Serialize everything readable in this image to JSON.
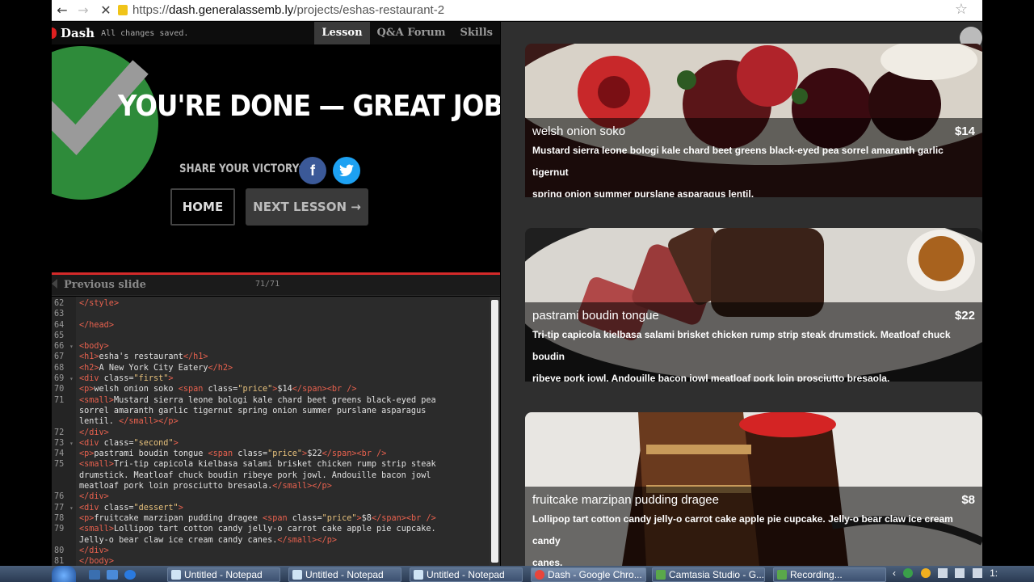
{
  "browser": {
    "url_scheme": "https://",
    "url_host": "dash.generalassemb.ly",
    "url_path": "/projects/eshas-restaurant-2"
  },
  "header": {
    "logo": "Dash",
    "status": "All changes saved.",
    "tabs": [
      {
        "label": "Lesson",
        "active": true
      },
      {
        "label": "Q&A Forum",
        "active": false
      },
      {
        "label": "Skills",
        "active": false
      }
    ]
  },
  "victory": {
    "title": "YOU'RE DONE — GREAT JOB!",
    "share_label": "SHARE YOUR VICTORY:",
    "facebook_glyph": "f",
    "twitter_glyph": "t",
    "home_button": "HOME",
    "next_button": "NEXT LESSON →"
  },
  "slides": {
    "prev_label": "Previous slide",
    "counter": "71/71"
  },
  "editor": {
    "lines": [
      {
        "n": "62",
        "fold": "",
        "t": "</style>"
      },
      {
        "n": "63",
        "fold": "",
        "t": ""
      },
      {
        "n": "64",
        "fold": "",
        "t": "</head>"
      },
      {
        "n": "65",
        "fold": "",
        "t": ""
      },
      {
        "n": "66",
        "fold": "▾",
        "t": "<body>"
      },
      {
        "n": "67",
        "fold": "",
        "t": "<h1>esha's restaurant</h1>"
      },
      {
        "n": "68",
        "fold": "",
        "t": "<h2>A New York City Eatery</h2>"
      },
      {
        "n": "69",
        "fold": "▾",
        "t": "<div class=\"first\">"
      },
      {
        "n": "70",
        "fold": "",
        "t": "<p>welsh onion soko <span class=\"price\">$14</span><br />"
      },
      {
        "n": "71",
        "fold": "",
        "t": "<small>Mustard sierra leone bologi kale chard beet greens black-eyed pea"
      },
      {
        "n": "",
        "fold": "",
        "t": "sorrel amaranth garlic tigernut spring onion summer purslane asparagus"
      },
      {
        "n": "",
        "fold": "",
        "t": "lentil. </small></p>"
      },
      {
        "n": "72",
        "fold": "",
        "t": "</div>"
      },
      {
        "n": "73",
        "fold": "▾",
        "t": "<div class=\"second\">"
      },
      {
        "n": "74",
        "fold": "",
        "t": "<p>pastrami boudin tongue <span class=\"price\">$22</span><br />"
      },
      {
        "n": "75",
        "fold": "",
        "t": "<small>Tri-tip capicola kielbasa salami brisket chicken rump strip steak"
      },
      {
        "n": "",
        "fold": "",
        "t": "drumstick. Meatloaf chuck boudin ribeye pork jowl. Andouille bacon jowl"
      },
      {
        "n": "",
        "fold": "",
        "t": "meatloaf pork loin prosciutto bresaola.</small></p>"
      },
      {
        "n": "76",
        "fold": "",
        "t": "</div>"
      },
      {
        "n": "77",
        "fold": "▾",
        "t": "<div class=\"dessert\">"
      },
      {
        "n": "78",
        "fold": "",
        "t": "<p>fruitcake marzipan pudding dragee <span class=\"price\">$8</span><br />"
      },
      {
        "n": "79",
        "fold": "",
        "t": "<small>Lollipop tart cotton candy jelly-o carrot cake apple pie cupcake."
      },
      {
        "n": "",
        "fold": "",
        "t": "Jelly-o bear claw ice cream candy canes.</small></p>"
      },
      {
        "n": "80",
        "fold": "",
        "t": "</div>"
      },
      {
        "n": "81",
        "fold": "",
        "t": "</body>"
      }
    ]
  },
  "menu": [
    {
      "name": "welsh onion soko",
      "price": "$14",
      "desc_1": "Mustard sierra leone bologi kale chard beet greens black-eyed pea sorrel amaranth garlic tigernut",
      "desc_2": "spring onion summer purslane asparagus lentil."
    },
    {
      "name": "pastrami boudin tongue",
      "price": "$22",
      "desc_1": "Tri-tip capicola kielbasa salami brisket chicken rump strip steak drumstick. Meatloaf chuck boudin",
      "desc_2": "ribeye pork jowl. Andouille bacon jowl meatloaf pork loin prosciutto bresaola."
    },
    {
      "name": "fruitcake marzipan pudding dragee",
      "price": "$8",
      "desc_1": "Lollipop tart cotton candy jelly-o carrot cake apple pie cupcake. Jelly-o bear claw ice cream candy",
      "desc_2": "canes."
    }
  ],
  "taskbar": {
    "tasks": [
      {
        "label": "Untitled - Notepad",
        "active": false
      },
      {
        "label": "Untitled - Notepad",
        "active": false
      },
      {
        "label": "Untitled - Notepad",
        "active": false
      },
      {
        "label": "Dash - Google Chro...",
        "active": true
      },
      {
        "label": "Camtasia Studio - G...",
        "active": false
      },
      {
        "label": "Recording...",
        "active": false
      }
    ],
    "tray_chevron": "‹",
    "tray_clock": "1:"
  },
  "colors": {
    "accent_red": "#d42a2a",
    "success_green": "#2e8b3a",
    "facebook_blue": "#3b5998",
    "twitter_blue": "#1da1f2"
  }
}
